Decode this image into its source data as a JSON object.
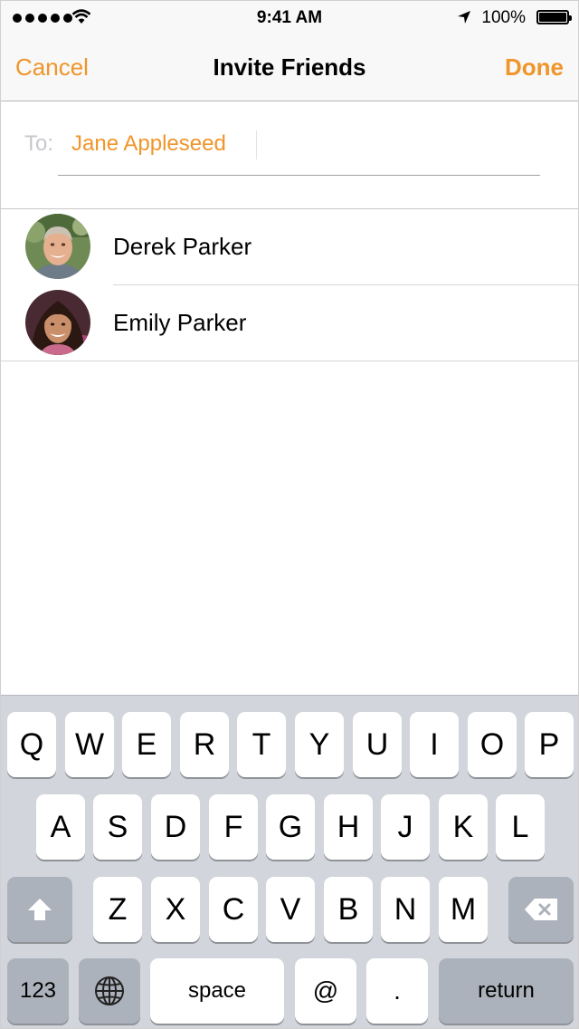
{
  "status_bar": {
    "time": "9:41 AM",
    "battery": "100%"
  },
  "nav": {
    "cancel": "Cancel",
    "title": "Invite Friends",
    "done": "Done"
  },
  "to_field": {
    "label": "To:",
    "recipient": "Jane Appleseed"
  },
  "contacts": [
    {
      "name": "Derek Parker",
      "avatar": "man-photo-avatar"
    },
    {
      "name": "Emily Parker",
      "avatar": "woman-photo-avatar"
    }
  ],
  "keyboard": {
    "row1": [
      "Q",
      "W",
      "E",
      "R",
      "T",
      "Y",
      "U",
      "I",
      "O",
      "P"
    ],
    "row2": [
      "A",
      "S",
      "D",
      "F",
      "G",
      "H",
      "J",
      "K",
      "L"
    ],
    "row3": [
      "Z",
      "X",
      "C",
      "V",
      "B",
      "N",
      "M"
    ],
    "numbers": "123",
    "space": "space",
    "at": "@",
    "period": ".",
    "return": "return"
  },
  "colors": {
    "accent": "#f0952a",
    "keyboard_bg": "#d2d5db",
    "key_dark": "#acb2bb"
  }
}
